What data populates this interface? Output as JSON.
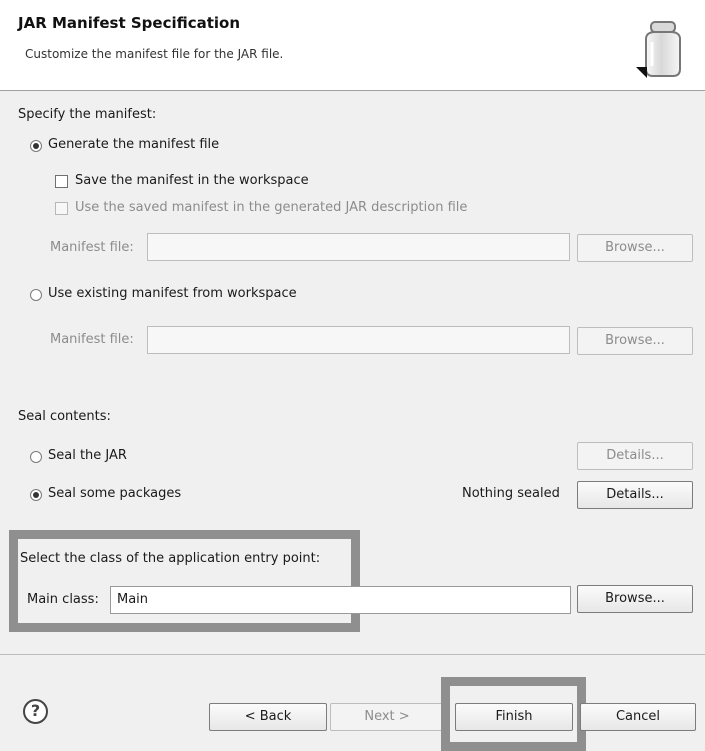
{
  "header": {
    "title": "JAR Manifest Specification",
    "description": "Customize the manifest file for the JAR file."
  },
  "manifest": {
    "section_label": "Specify the manifest:",
    "generate_label": "Generate the manifest file",
    "save_label": "Save the manifest in the workspace",
    "use_saved_label": "Use the saved manifest in the generated JAR description file",
    "manifest_file_label_1": "Manifest file:",
    "manifest_file_value_1": "",
    "browse_1": "Browse...",
    "use_existing_label": "Use existing manifest from workspace",
    "manifest_file_label_2": "Manifest file:",
    "manifest_file_value_2": "",
    "browse_2": "Browse..."
  },
  "seal": {
    "section_label": "Seal contents:",
    "seal_jar_label": "Seal the JAR",
    "details_1": "Details...",
    "seal_packages_label": "Seal some packages",
    "nothing_sealed": "Nothing sealed",
    "details_2": "Details..."
  },
  "entry": {
    "section_label": "Select the class of the application entry point:",
    "main_class_label": "Main class:",
    "main_class_value": "Main",
    "browse": "Browse..."
  },
  "footer": {
    "help_symbol": "?",
    "back": "< Back",
    "next": "Next >",
    "finish": "Finish",
    "cancel": "Cancel"
  },
  "icons": {
    "help": "help-icon",
    "jar": "jar-icon"
  }
}
